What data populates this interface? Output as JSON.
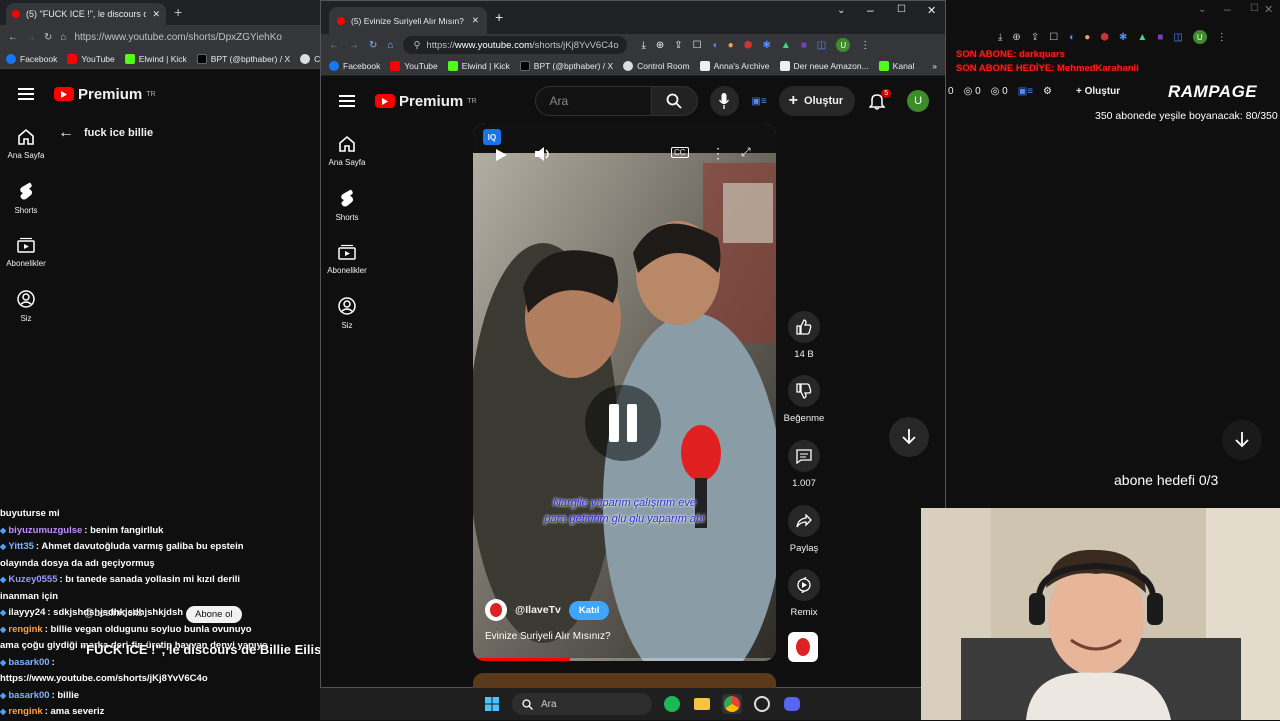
{
  "bg_browser": {
    "tab_title": "(5) \"FUCK ICE !\", le discours de B",
    "url": "https://www.youtube.com/shorts/DpxZGYiehKo",
    "bookmarks": [
      "Facebook",
      "YouTube",
      "Elwind | Kick",
      "BPT (@bpthaber) / X",
      "Co"
    ],
    "logo_text": "Premium",
    "logo_region": "TR",
    "rail": [
      "Ana Sayfa",
      "Shorts",
      "Abonelikler",
      "Siz"
    ],
    "search_query": "fuck ice billie"
  },
  "fg_browser": {
    "tab_title": "(5) Evinize Suriyeli Alır Mısın?",
    "url_prefix": "https://",
    "url_host": "www.youtube.com",
    "url_path": "/shorts/jKj8YvV6C4o",
    "bookmarks": [
      "Facebook",
      "YouTube",
      "Elwind | Kick",
      "BPT (@bpthaber) / X",
      "Control Room",
      "Anna's Archive",
      "Der neue Amazon...",
      "Kanal"
    ],
    "logo_text": "Premium",
    "logo_region": "TR",
    "search_placeholder": "Ara",
    "create_label": "Oluştur",
    "notif_count": "5",
    "avatar_letter": "U",
    "rail": [
      "Ana Sayfa",
      "Shorts",
      "Abonelikler",
      "Siz"
    ]
  },
  "short": {
    "caption_line1": "Nargile yaparım çalışırım eve",
    "caption_line2": "para getiririm glu glu yaparım abi",
    "channel": "@IlaveTv",
    "join_label": "Katıl",
    "title": "Evinize Suriyeli Alır Mısınız?",
    "progress": 0.32,
    "actions": {
      "likes": "14 B",
      "dislike": "Beğenme",
      "comments": "1.007",
      "share": "Paylaş",
      "remix": "Remix"
    }
  },
  "chat": [
    {
      "user": "",
      "text": "buyuturse mi",
      "color": "#ffffff"
    },
    {
      "user": "biyuzumuzgulse",
      "text": ": benim fangirlluk",
      "color": "#c18cff"
    },
    {
      "user": "Yitt35",
      "text": ": Ahmet davutoğluda varmış galiba bu epstein",
      "color": "#7fb2ff"
    },
    {
      "user": "",
      "text": "olayında dosya da adı geçiyormuş",
      "color": "#ffffff"
    },
    {
      "user": "Kuzey0555",
      "text": ": bı tanede sanada yollasin mi kızıl derili",
      "color": "#9b9bff"
    },
    {
      "user": "",
      "text": "inanman için",
      "color": "#ffffff"
    },
    {
      "user": "ilayyy24",
      "text": ": sdkjshdshjsdhkjsdhjshkjdsh",
      "color": "#ffffff"
    },
    {
      "user": "rengink",
      "text": ": billie vegan oldugunu soyluo bunla ovunuyo",
      "color": "#ff9f43"
    },
    {
      "user": "",
      "text": "ama çoğu giydiği marka deri-fin üretip hayvan denyi yapıyo",
      "color": "#ffffff"
    },
    {
      "user": "basark00",
      "text": ":",
      "color": "#7fb2ff"
    },
    {
      "user": "",
      "text": "https://www.youtube.com/shorts/jKj8YvV6C4o",
      "color": "#ffffff"
    },
    {
      "user": "basark00",
      "text": ": billie",
      "color": "#7fb2ff"
    },
    {
      "user": "rengink",
      "text": ": ama severiz",
      "color": "#ff9f43"
    }
  ],
  "overlay": {
    "channel_handle": "@LesInrocks",
    "subscribe": "Abone ol",
    "video_title": "\"FUCK ICE !\", le discours de Billie Eilis"
  },
  "stream": {
    "last_sub": "SON ABONE: darkquars",
    "last_gift": "SON ABONE HEDİYE: MehmedKarahanli",
    "rampage": "RAMPAGE",
    "sub_goal": "350 abonede yeşile boyanacak: 80/350",
    "abone_hedefi": "abone hedefi 0/3",
    "counts": [
      "0",
      "0",
      "0"
    ],
    "right_create": "Oluştur"
  },
  "taskbar": {
    "search_placeholder": "Ara"
  },
  "colors": {
    "yt_red": "#ff0000",
    "join_blue": "#3ea6ff",
    "avatar_green": "#3d8b2b"
  }
}
